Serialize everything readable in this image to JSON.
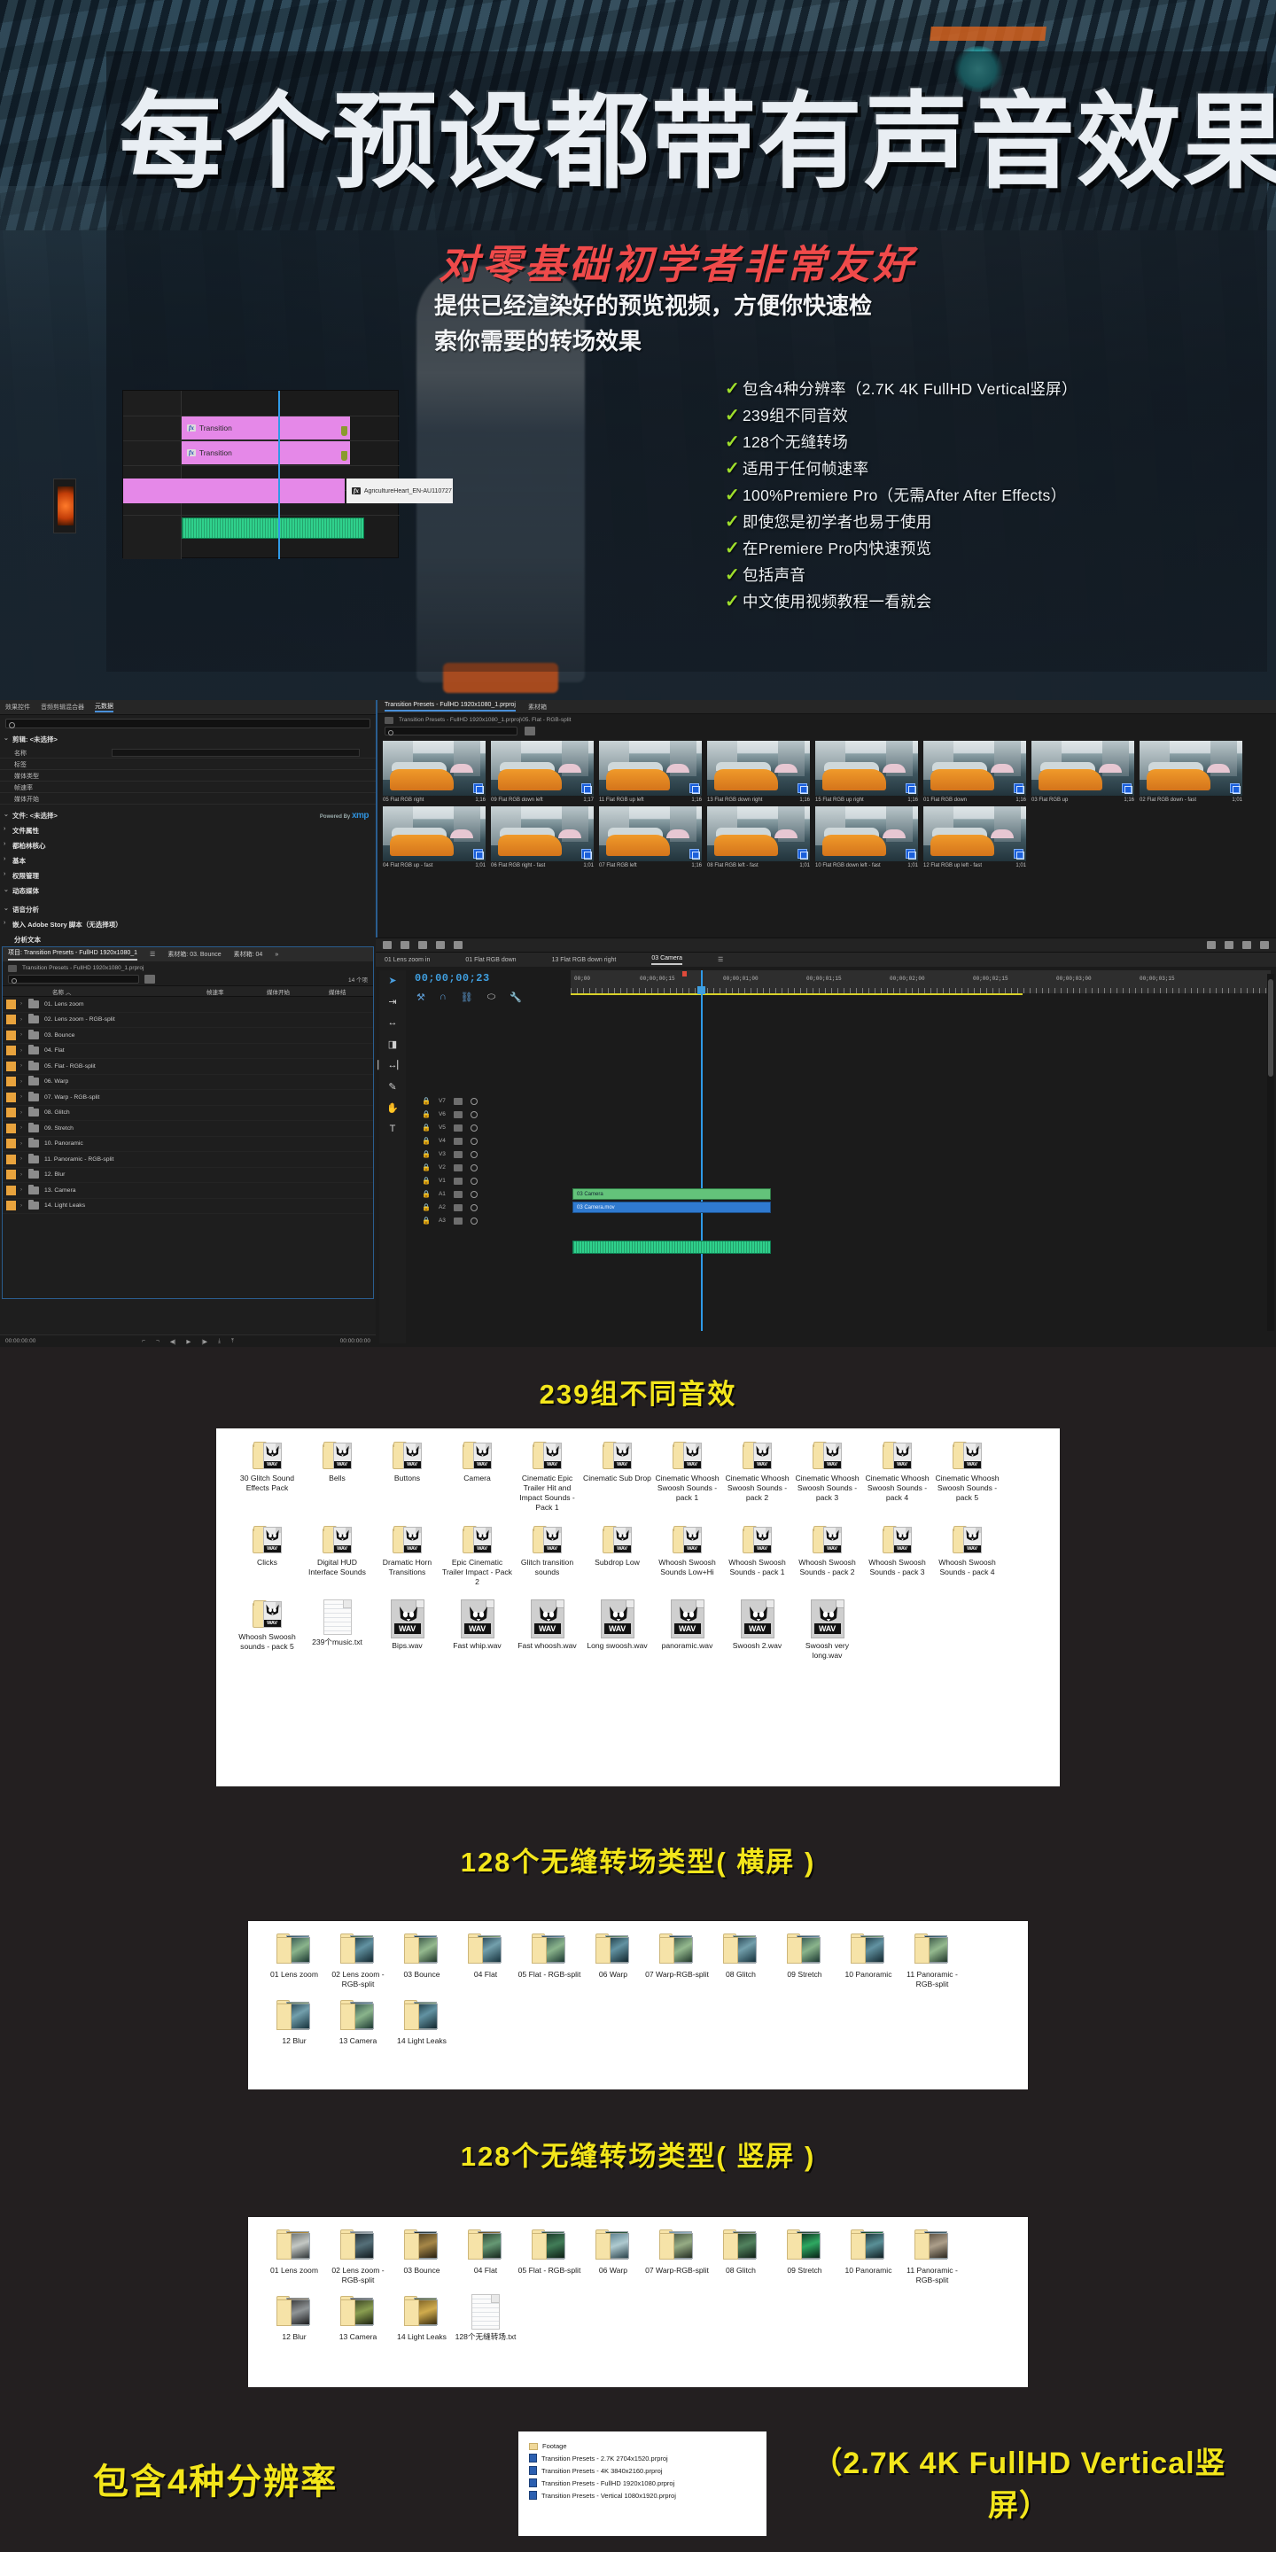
{
  "hero": {
    "title": "每个预设都带有声音效果",
    "subtitle": "对零基础初学者非常友好",
    "description": "提供已经渲染好的预览视频，方便你快速检索你需要的转场效果",
    "features": [
      "包含4种分辨率（2.7K 4K FullHD Vertical竖屏）",
      "239组不同音效",
      "128个无缝转场",
      "适用于任何帧速率",
      "100%Premiere Pro（无需After After Effects）",
      "即使您是初学者也易于使用",
      "在Premiere Pro内快速预览",
      "包括声音",
      "中文使用视频教程一看就会"
    ],
    "check_glyph": "✓",
    "check_color": "#9ede2c",
    "timeline_clips": [
      {
        "label": "Transition",
        "fx": "fx"
      },
      {
        "label": "Transition",
        "fx": "fx"
      },
      {
        "label": "AgricultureHeart_EN-AU110727",
        "fx": "fx"
      }
    ]
  },
  "premiere": {
    "metadata_panel": {
      "tabs": [
        "效果控件",
        "音频剪辑混合器",
        "元数据"
      ],
      "active_tab": "元数据",
      "search_placeholder": "",
      "section_clip": "剪辑: <未选择>",
      "clip_rows": [
        "名称",
        "标签",
        "媒体类型",
        "帧速率",
        "媒体开始"
      ],
      "section_file": "文件: <未选择>",
      "xmp_prefix": "Powered By",
      "xmp_logo": "xmp",
      "file_rows": [
        "文件属性",
        "都柏林核心",
        "基本",
        "权限管理",
        "动态媒体"
      ],
      "section_speech": "语音分析",
      "speech_rows": [
        "嵌入 Adobe Story 脚本（无选择项）",
        "分析文本"
      ],
      "tc_left": "00:00:00:00",
      "tc_right": "00:00:00:00"
    },
    "project_panel": {
      "tabs": [
        "项目: Transition Presets - FullHD 1920x1080_1",
        "素材箱: 03. Bounce",
        "素材箱: 04"
      ],
      "active_tab": "项目: Transition Presets - FullHD 1920x1080_1",
      "path": "Transition Presets - FullHD 1920x1080_1.prproj",
      "item_count": "14 个项",
      "columns": [
        "名称",
        "帧速率",
        "媒体开始",
        "媒体结"
      ],
      "sort_arrow": "︿",
      "rows": [
        "01. Lens zoom",
        "02. Lens zoom - RGB-split",
        "03. Bounce",
        "04. Flat",
        "05. Flat - RGB-split",
        "06. Warp",
        "07. Warp - RGB-split",
        "08. Glitch",
        "09. Stretch",
        "10. Panoramic",
        "11. Panoramic - RGB-split",
        "12. Blur",
        "13. Camera",
        "14. Light Leaks"
      ]
    },
    "bin_panel": {
      "tabs": [
        "Transition Presets - FullHD 1920x1080_1.prproj",
        "素材箱"
      ],
      "path": "Transition Presets - FullHD 1920x1080_1.prproj\\05. Flat - RGB-split",
      "items_row1": [
        {
          "name": "05 Flat RGB right",
          "dur": "1;16"
        },
        {
          "name": "09 Flat RGB down left",
          "dur": "1;17"
        },
        {
          "name": "11 Flat RGB up left",
          "dur": "1;16"
        },
        {
          "name": "13 Flat RGB down right",
          "dur": "1;16"
        },
        {
          "name": "15 Flat RGB up right",
          "dur": "1;16"
        },
        {
          "name": "01 Flat RGB down",
          "dur": "1;16"
        },
        {
          "name": "03 Flat RGB up",
          "dur": "1;16"
        }
      ],
      "items_row2": [
        {
          "name": "02 Flat RGB down - fast",
          "dur": "1;01"
        },
        {
          "name": "04 Flat RGB up - fast",
          "dur": "1;01"
        },
        {
          "name": "06 Flat RGB right - fast",
          "dur": "1;01"
        },
        {
          "name": "07 Flat RGB left",
          "dur": "1;16"
        },
        {
          "name": "08 Flat RGB left - fast",
          "dur": "1;01"
        },
        {
          "name": "10 Flat RGB down left - fast",
          "dur": "1;01"
        },
        {
          "name": "12 Flat RGB up left - fast",
          "dur": "1;01"
        }
      ]
    },
    "timeline_panel": {
      "tabs": [
        "01 Lens zoom in",
        "01 Flat RGB down",
        "13 Flat RGB down right",
        "03 Camera"
      ],
      "active_tab": "03 Camera",
      "timecode": "00;00;00;23",
      "ruler_labels": [
        "00;00",
        "00;00;00;15",
        "00;00;01;00",
        "00;00;01;15",
        "00;00;02;00",
        "00;00;02;15",
        "00;00;03;00",
        "00;00;03;15"
      ],
      "tracks": [
        "V7",
        "V6",
        "V5",
        "V4",
        "V3",
        "V2",
        "V1",
        "A1",
        "A2",
        "A3"
      ],
      "clips": [
        {
          "name": "03 Camera",
          "type": "video"
        },
        {
          "name": "03 Camera.mov",
          "type": "video-blue"
        },
        {
          "name": "",
          "type": "audio"
        }
      ]
    }
  },
  "section_sounds": {
    "title": "239组不同音效",
    "folders": [
      "30 Glitch Sound Effects Pack",
      "Bells",
      "Buttons",
      "Camera",
      "Cinematic Epic Trailer Hit and Impact Sounds - Pack 1",
      "Cinematic Sub Drop",
      "Cinematic Whoosh Swoosh Sounds - pack 1",
      "Cinematic Whoosh Swoosh Sounds - pack 2",
      "Cinematic Whoosh Swoosh Sounds - pack 3",
      "Cinematic Whoosh Swoosh Sounds - pack 4",
      "Cinematic Whoosh Swoosh Sounds - pack 5",
      "Clicks",
      "Digital HUD Interface Sounds",
      "Dramatic Horn Transitions",
      "Epic Cinematic Trailer Impact - Pack 2",
      "Glitch transition sounds",
      "Subdrop Low",
      "Whoosh Swoosh Sounds Low+Hi",
      "Whoosh Swoosh Sounds - pack 1",
      "Whoosh Swoosh Sounds - pack 2",
      "Whoosh Swoosh Sounds - pack 3",
      "Whoosh Swoosh Sounds - pack 4",
      "Whoosh Swoosh sounds - pack 5"
    ],
    "txt_file": "239个music.txt",
    "wav_files": [
      "Bips.wav",
      "Fast whip.wav",
      "Fast whoosh.wav",
      "Long swoosh.wav",
      "panoramic.wav",
      "Swoosh 2.wav",
      "Swoosh very long.wav"
    ],
    "wav_badge": "WAV"
  },
  "section_horizontal": {
    "title": "128个无缝转场类型( 横屏 )",
    "folders": [
      "01 Lens zoom",
      "02 Lens zoom - RGB-split",
      "03 Bounce",
      "04 Flat",
      "05 Flat - RGB-split",
      "06 Warp",
      "07 Warp-RGB-split",
      "08 Glitch",
      "09 Stretch",
      "10 Panoramic",
      "11 Panoramic - RGB-split",
      "12 Blur",
      "13 Camera",
      "14 Light Leaks"
    ]
  },
  "section_vertical": {
    "title": "128个无缝转场类型( 竖屏 )",
    "folders": [
      "01 Lens zoom",
      "02 Lens zoom - RGB-split",
      "03 Bounce",
      "04 Flat",
      "05 Flat - RGB-split",
      "06 Warp",
      "07 Warp-RGB-split",
      "08 Glitch",
      "09 Stretch",
      "10 Panoramic",
      "11 Panoramic - RGB-split",
      "12 Blur",
      "13 Camera",
      "14 Light Leaks"
    ],
    "txt_file": "128个无缝转场.txt"
  },
  "section_resolutions": {
    "left_title": "包含4种分辨率",
    "right_title": "（2.7K 4K FullHD Vertical竖屏）",
    "files": [
      "Footage",
      "Transition Presets - 2.7K 2704x1520.prproj",
      "Transition Presets - 4K 3840x2160.prproj",
      "Transition Presets - FullHD 1920x1080.prproj",
      "Transition Presets - Vertical 1080x1920.prproj"
    ]
  },
  "colors": {
    "accent_yellow": "#f3e61b",
    "accent_red": "#ef4a4a",
    "check_green": "#9ede2c",
    "clip_pink": "#e588e8",
    "audio_green": "#2fd18c",
    "page_bg": "#231f20"
  }
}
